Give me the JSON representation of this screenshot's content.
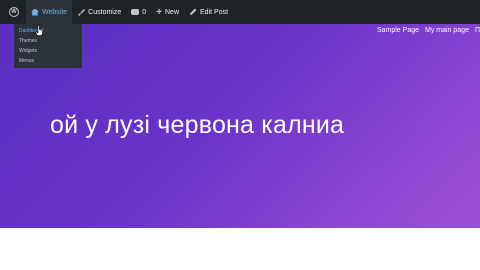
{
  "adminbar": {
    "site_label": "Website",
    "customize_label": "Customize",
    "comments_count": "0",
    "new_label": "New",
    "edit_label": "Edit Post"
  },
  "site_menu": {
    "items": [
      "Dashboard",
      "Themes",
      "Widgets",
      "Menus"
    ]
  },
  "nav": {
    "items": [
      "Sample Page",
      "My main page",
      "П"
    ]
  },
  "hero": {
    "title": "ой у лузі червона калниа"
  },
  "colors": {
    "adminbar_bg": "#1d2327",
    "accent": "#72aee6",
    "gradient_start": "#5b2fc4",
    "gradient_end": "#9c4fd6"
  }
}
